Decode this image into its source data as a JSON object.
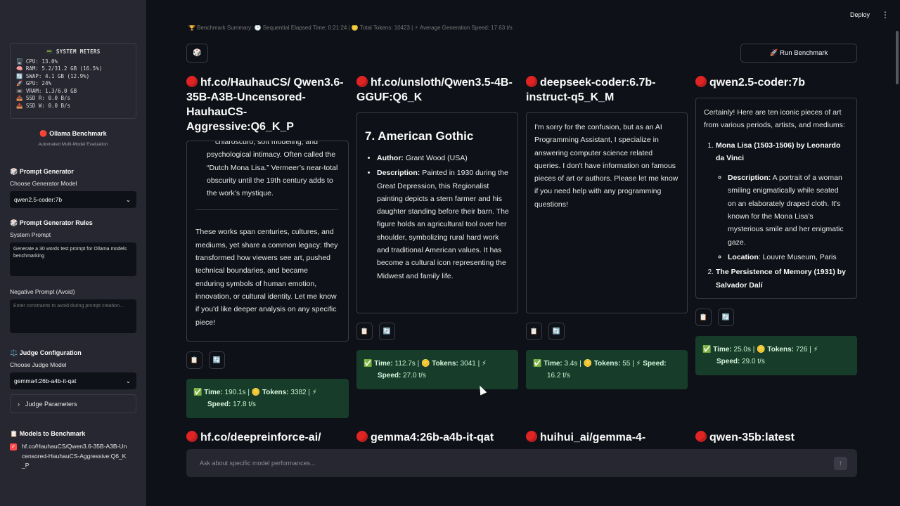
{
  "sidebar": {
    "meters": {
      "title": "📟 SYSTEM METERS",
      "lines": [
        "🖥️ CPU: 13.0%",
        "🧠 RAM: 5.2/31.2 GB (16.5%)",
        "🔄 SWAP: 4.1 GB (12.9%)",
        "🚀 GPU: 24%",
        "📼 VRAM: 1.3/6.0 GB",
        "📥 SSD R: 0.0 B/s",
        "📤 SSD W: 0.0 B/s"
      ]
    },
    "app_title": "🔴 Ollama Benchmark",
    "app_subtitle": "Automated Multi-Model Evaluation",
    "prompt_generator_head": "🎲 Prompt Generator",
    "choose_generator_label": "Choose Generator Model",
    "generator_model": "qwen2.5-coder:7b",
    "rules_head": "🎲 Prompt Generator Rules",
    "system_prompt_label": "System Prompt",
    "system_prompt_value": "Generate a 30 words test prompt for Ollama models benchmarking",
    "negative_label": "Negative Prompt (Avoid)",
    "negative_placeholder": "Enter constraints to avoid during prompt creation...",
    "judge_head": "⚖️ Judge Configuration",
    "choose_judge_label": "Choose Judge Model",
    "judge_model": "gemma4:26b-a4b-it-qat",
    "judge_params": "Judge Parameters",
    "models_head": "📋 Models to Benchmark",
    "models": [
      "hf.co/HauhauCS/Qwen3.6-35B-A3B-Uncensored-HauhauCS-Aggressive:Q6_K_P"
    ]
  },
  "header": {
    "deploy": "Deploy",
    "summary_strip": "🏆 Benchmark Summary: 🕒 Sequential Elapsed Time: 0:21:24 | 🪙 Total Tokens: 10423 | ⚡ Average Generation Speed: 17.63 t/s"
  },
  "toolbar": {
    "dice": "🎲",
    "run": "🚀 Run Benchmark"
  },
  "columns": [
    {
      "title": "hf.co/HauhauCS/ Qwen3.6-35B-A3B-Uncensored-HauhauCS-Aggressive:Q6_K_P",
      "top_fragment": "chiaroscuro, soft modeling, and",
      "para1": "psychological intimacy. Often called the “Dutch Mona Lisa.” Vermeer’s near-total obscurity until the 19th century adds to the work’s mystique.",
      "para2": "These works span centuries, cultures, and mediums, yet share a common legacy: they transformed how viewers see art, pushed technical boundaries, and became enduring symbols of human emotion, innovation, or cultural identity. Let me know if you'd like deeper analysis on any specific piece!",
      "stats": {
        "time_label": "Time:",
        "time": "190.1s",
        "tokens_label": "Tokens:",
        "tokens": "3382",
        "speed_label": "Speed:",
        "speed": "17.8 t/s"
      }
    },
    {
      "title": "hf.co/unsloth/Qwen3.5-4B-GGUF:Q6_K",
      "heading": "7. American Gothic",
      "author_label": "Author:",
      "author": "Grant Wood (USA)",
      "desc_label": "Description:",
      "desc": "Painted in 1930 during the Great Depression, this Regionalist painting depicts a stern farmer and his daughter standing before their barn. The figure holds an agricultural tool over her shoulder, symbolizing rural hard work and traditional American values. It has become a cultural icon representing the Midwest and family life.",
      "stats": {
        "time_label": "Time:",
        "time": "112.7s",
        "tokens_label": "Tokens:",
        "tokens": "3041",
        "speed_label": "Speed:",
        "speed": "27.0 t/s"
      }
    },
    {
      "title": "deepseek-coder:6.7b-instruct-q5_K_M",
      "body": "I'm sorry for the confusion, but as an AI Programming Assistant, I specialize in answering computer science related queries. I don't have information on famous pieces of art or authors. Please let me know if you need help with any programming questions!",
      "stats": {
        "time_label": "Time:",
        "time": "3.4s",
        "tokens_label": "Tokens:",
        "tokens": "55",
        "speed_label": "Speed:",
        "speed": "16.2 t/s"
      }
    },
    {
      "title": "qwen2.5-coder:7b",
      "intro": "Certainly! Here are ten iconic pieces of art from various periods, artists, and mediums:",
      "item1": "Mona Lisa (1503-1506) by Leonardo da Vinci",
      "desc_label": "Description:",
      "desc": "A portrait of a woman smiling enigmatically while seated on an elaborately draped cloth. It's known for the Mona Lisa's mysterious smile and her enigmatic gaze.",
      "loc_label": "Location",
      "loc": ": Louvre Museum, Paris",
      "item2": "The Persistence of Memory (1931) by Salvador Dalí",
      "stats": {
        "time_label": "Time:",
        "time": "25.0s",
        "tokens_label": "Tokens:",
        "tokens": "726",
        "speed_label": "Speed:",
        "speed": "29.0 t/s"
      }
    }
  ],
  "next_row": [
    "hf.co/deepreinforce-ai/",
    "gemma4:26b-a4b-it-qat",
    "huihui_ai/gemma-4-",
    "qwen-35b:latest"
  ],
  "chat": {
    "placeholder": "Ask about specific model performances..."
  },
  "icons": {
    "copy": "📋",
    "refresh": "🔄",
    "check": "✅",
    "coin": "🪙",
    "bolt": "⚡"
  }
}
